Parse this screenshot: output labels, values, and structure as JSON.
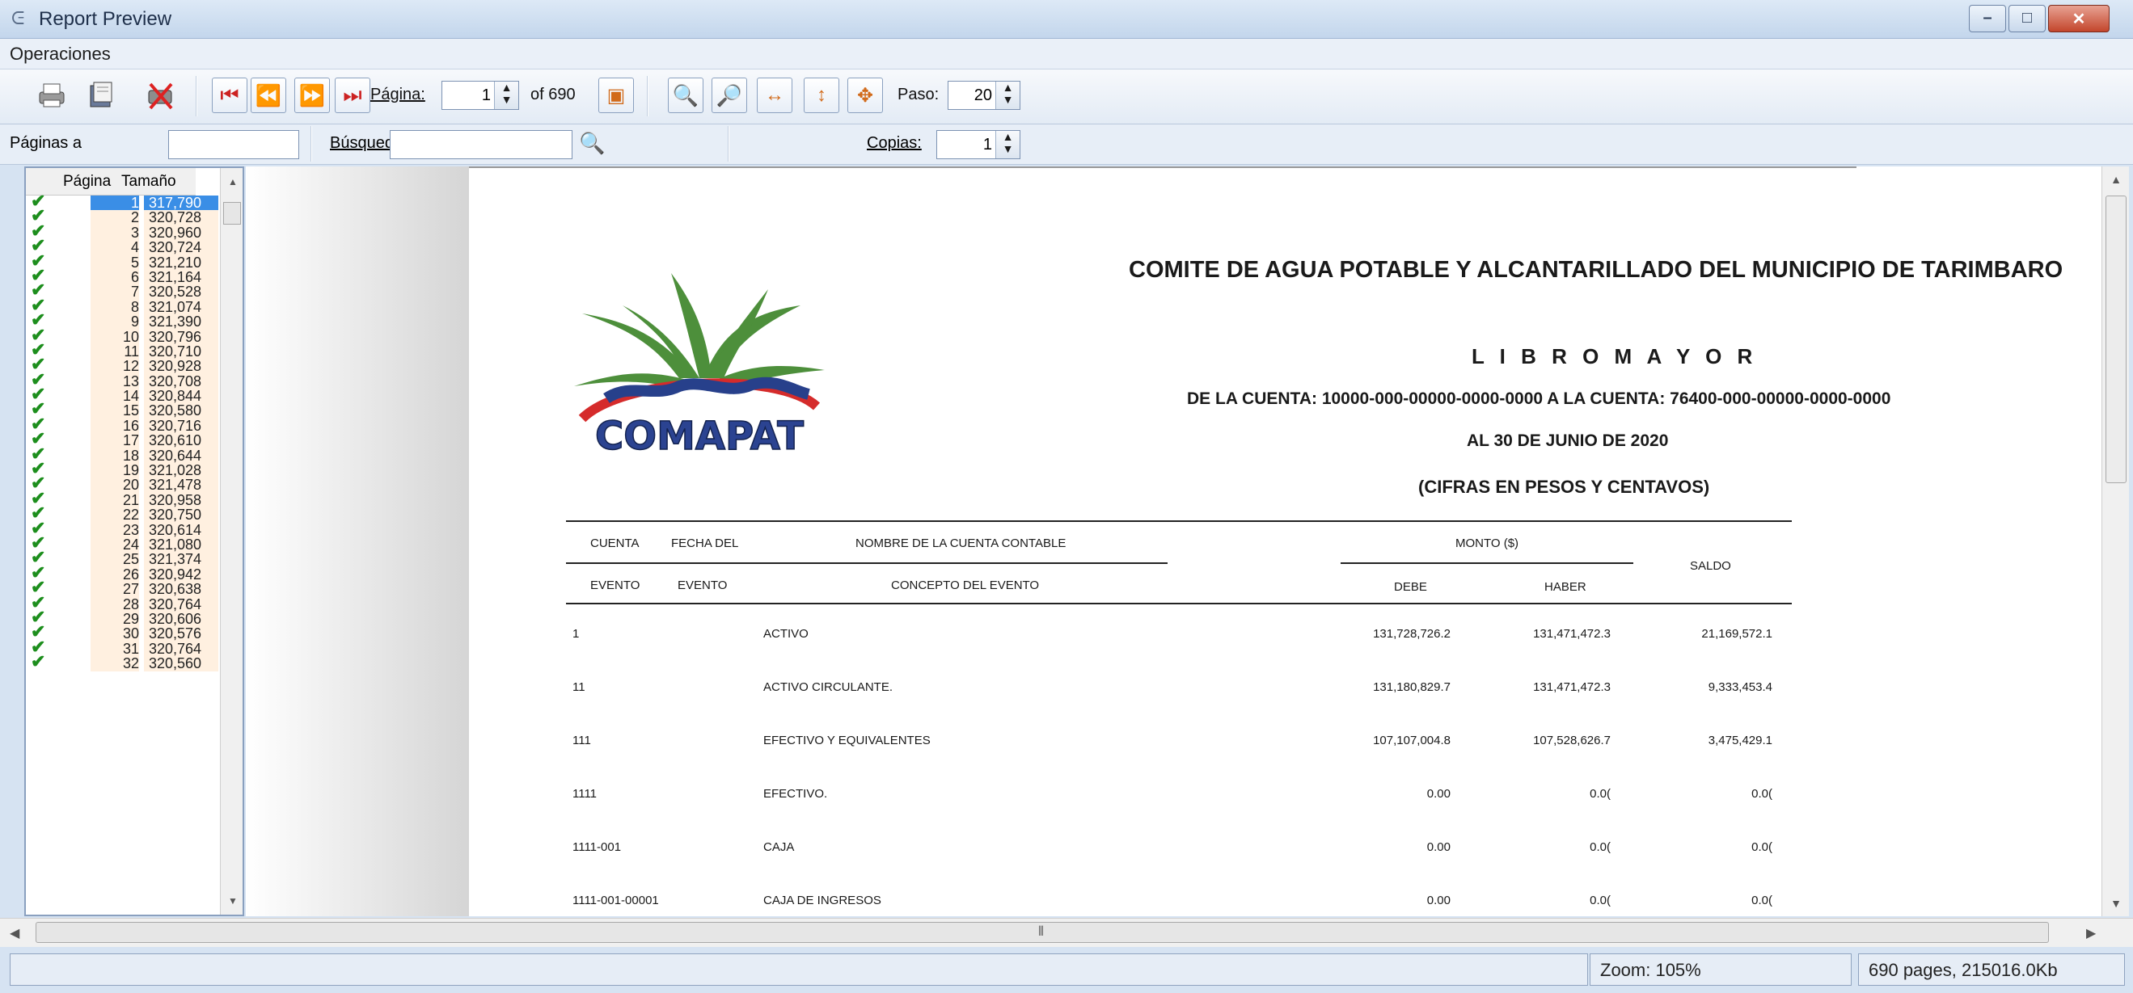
{
  "window": {
    "title": "Report Preview"
  },
  "menu": {
    "items": [
      "Operaciones"
    ]
  },
  "toolbar": {
    "page_label": "Página:",
    "page_value": "1",
    "page_of": "of 690",
    "step_label": "Paso:",
    "step_value": "20",
    "icons": [
      "print-icon",
      "print-setup-icon",
      "close-preview-icon",
      "first-page-icon",
      "previous-page-icon",
      "next-page-icon",
      "last-page-icon",
      "page-goto-icon",
      "zoom-in-icon",
      "zoom-out-icon",
      "fit-width-icon",
      "fit-height-icon",
      "fit-page-icon"
    ]
  },
  "row2": {
    "pages_label": "Páginas a",
    "search_label": "Búsqued",
    "search_value": "",
    "copies_label": "Copias:",
    "copies_value": "1"
  },
  "pagelist": {
    "col_page": "Página",
    "col_size": "Tamaño",
    "rows": [
      {
        "page": "1",
        "size": "317,790"
      },
      {
        "page": "2",
        "size": "320,728"
      },
      {
        "page": "3",
        "size": "320,960"
      },
      {
        "page": "4",
        "size": "320,724"
      },
      {
        "page": "5",
        "size": "321,210"
      },
      {
        "page": "6",
        "size": "321,164"
      },
      {
        "page": "7",
        "size": "320,528"
      },
      {
        "page": "8",
        "size": "321,074"
      },
      {
        "page": "9",
        "size": "321,390"
      },
      {
        "page": "10",
        "size": "320,796"
      },
      {
        "page": "11",
        "size": "320,710"
      },
      {
        "page": "12",
        "size": "320,928"
      },
      {
        "page": "13",
        "size": "320,708"
      },
      {
        "page": "14",
        "size": "320,844"
      },
      {
        "page": "15",
        "size": "320,580"
      },
      {
        "page": "16",
        "size": "320,716"
      },
      {
        "page": "17",
        "size": "320,610"
      },
      {
        "page": "18",
        "size": "320,644"
      },
      {
        "page": "19",
        "size": "321,028"
      },
      {
        "page": "20",
        "size": "321,478"
      },
      {
        "page": "21",
        "size": "320,958"
      },
      {
        "page": "22",
        "size": "320,750"
      },
      {
        "page": "23",
        "size": "320,614"
      },
      {
        "page": "24",
        "size": "321,080"
      },
      {
        "page": "25",
        "size": "321,374"
      },
      {
        "page": "26",
        "size": "320,942"
      },
      {
        "page": "27",
        "size": "320,638"
      },
      {
        "page": "28",
        "size": "320,764"
      },
      {
        "page": "29",
        "size": "320,606"
      },
      {
        "page": "30",
        "size": "320,576"
      },
      {
        "page": "31",
        "size": "320,764"
      },
      {
        "page": "32",
        "size": "320,560"
      }
    ]
  },
  "report": {
    "logo_text": "COMAPAT",
    "org": "COMITE DE AGUA POTABLE Y ALCANTARILLADO DEL MUNICIPIO DE TARIMBARO",
    "title": "L I B R O   M A Y O R",
    "range": "DE LA CUENTA: 10000-000-00000-0000-0000 A LA CUENTA: 76400-000-00000-0000-0000",
    "date": "AL 30 DE JUNIO DE 2020",
    "units": "(CIFRAS EN PESOS Y CENTAVOS)",
    "headers": {
      "cuenta": "CUENTA",
      "fecha_del": "FECHA DEL",
      "nombre": "NOMBRE DE LA CUENTA CONTABLE",
      "monto": "MONTO ($)",
      "saldo": "SALDO",
      "evento1": "EVENTO",
      "evento2": "EVENTO",
      "concepto": "CONCEPTO DEL EVENTO",
      "debe": "DEBE",
      "haber": "HABER"
    },
    "rows": [
      {
        "cuenta": "1",
        "nombre": "ACTIVO",
        "debe": "131,728,726.2",
        "haber": "131,471,472.3",
        "saldo": "21,169,572.1"
      },
      {
        "cuenta": "11",
        "nombre": "ACTIVO CIRCULANTE.",
        "debe": "131,180,829.7",
        "haber": "131,471,472.3",
        "saldo": "9,333,453.4"
      },
      {
        "cuenta": "111",
        "nombre": "EFECTIVO Y EQUIVALENTES",
        "debe": "107,107,004.8",
        "haber": "107,528,626.7",
        "saldo": "3,475,429.1"
      },
      {
        "cuenta": "1111",
        "nombre": "EFECTIVO.",
        "debe": "0.00",
        "haber": "0.0(",
        "saldo": "0.0("
      },
      {
        "cuenta": "1111-001",
        "nombre": "CAJA",
        "debe": "0.00",
        "haber": "0.0(",
        "saldo": "0.0("
      },
      {
        "cuenta": "1111-001-00001",
        "nombre": "CAJA DE INGRESOS",
        "debe": "0.00",
        "haber": "0.0(",
        "saldo": "0.0("
      }
    ]
  },
  "status": {
    "zoom": "Zoom: 105%",
    "pages": "690 pages, 215016.0Kb"
  },
  "colors": {
    "accent": "#3a8ee6",
    "check": "#1d8e1d",
    "logo_red": "#d52b2b",
    "logo_blue": "#27408b"
  }
}
